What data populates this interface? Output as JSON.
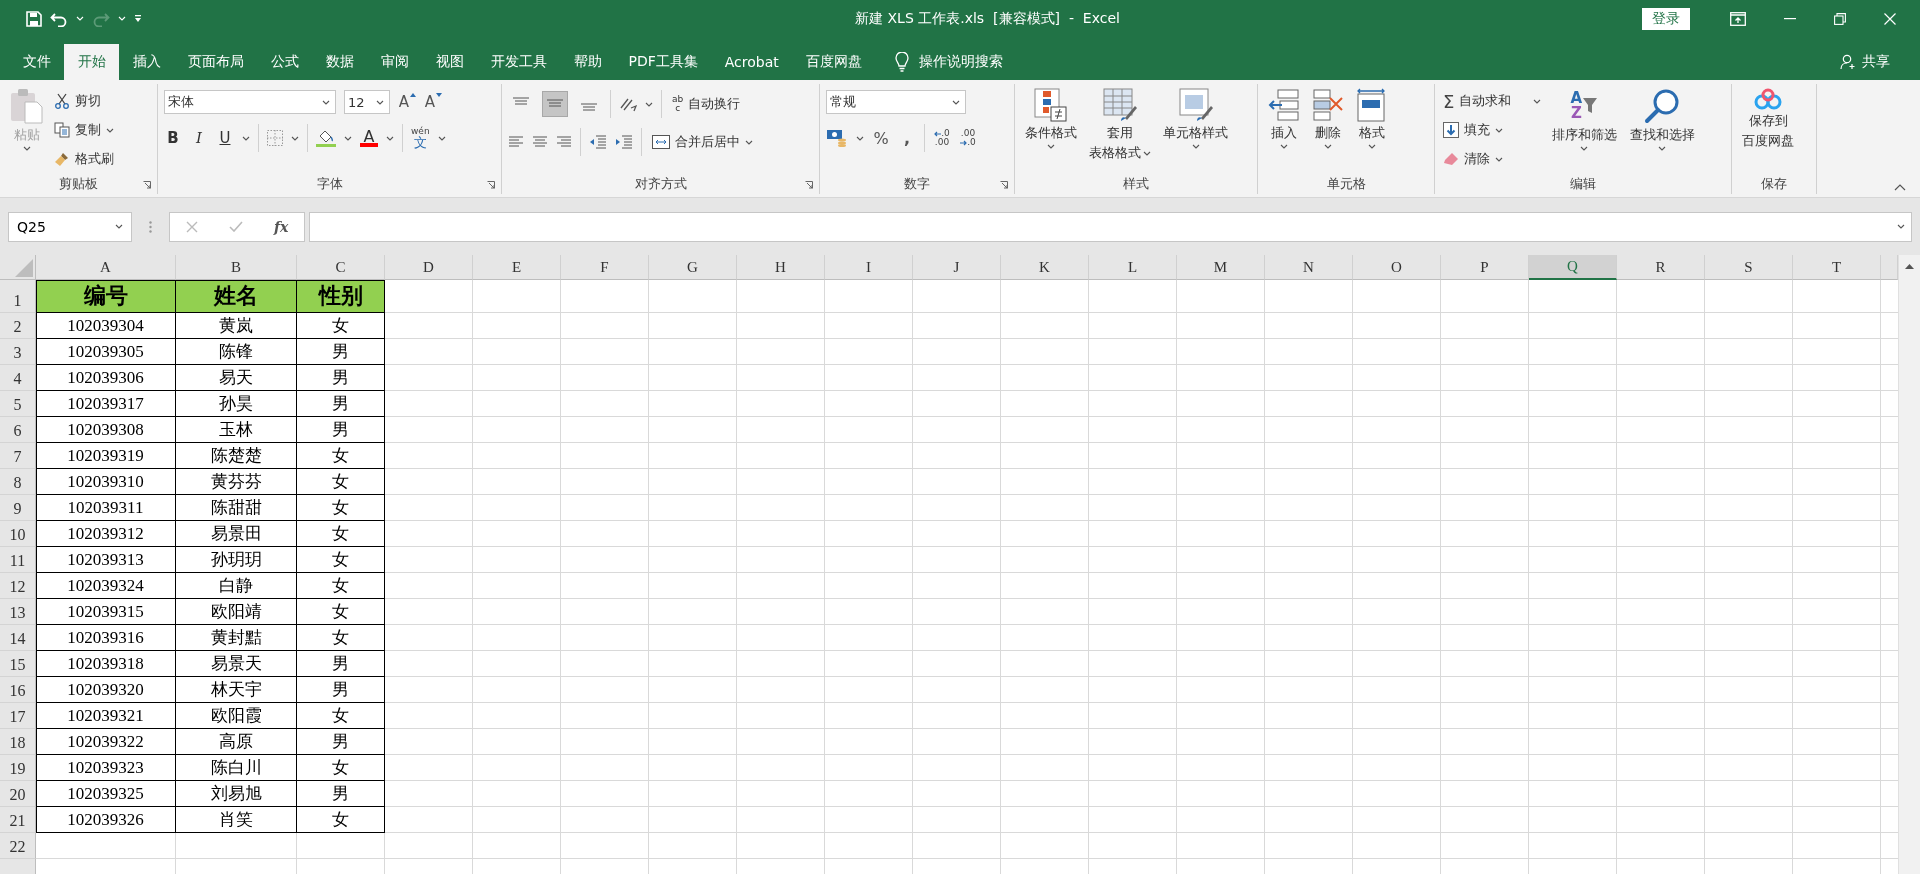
{
  "window": {
    "title": "新建 XLS 工作表.xls  [兼容模式]  -  Excel",
    "login_button": "登录"
  },
  "tabs": [
    {
      "label": "文件",
      "selected": false
    },
    {
      "label": "开始",
      "selected": true
    },
    {
      "label": "插入",
      "selected": false
    },
    {
      "label": "页面布局",
      "selected": false
    },
    {
      "label": "公式",
      "selected": false
    },
    {
      "label": "数据",
      "selected": false
    },
    {
      "label": "审阅",
      "selected": false
    },
    {
      "label": "视图",
      "selected": false
    },
    {
      "label": "开发工具",
      "selected": false
    },
    {
      "label": "帮助",
      "selected": false
    },
    {
      "label": "PDF工具集",
      "selected": false
    },
    {
      "label": "Acrobat",
      "selected": false
    },
    {
      "label": "百度网盘",
      "selected": false
    }
  ],
  "tell_me": "操作说明搜索",
  "share": "共享",
  "ribbon": {
    "clipboard": {
      "label": "剪贴板",
      "paste": {
        "label": "粘贴",
        "disabled": true
      },
      "items": [
        "剪切",
        "复制",
        "格式刷"
      ]
    },
    "font": {
      "label": "字体",
      "font_name": "宋体",
      "font_size": "12",
      "grow": "A",
      "shrink": "A",
      "styles": [
        "B",
        "I",
        "U"
      ],
      "color_letter": "A",
      "phonetic": [
        "wén",
        "文"
      ]
    },
    "alignment": {
      "label": "对齐方式",
      "vertical": [
        {
          "selected": false
        },
        {
          "selected": true
        },
        {
          "selected": false
        }
      ],
      "wrap_letters": [
        "ab",
        "c"
      ],
      "wrap_text": "自动换行",
      "merge_center": "合并后居中"
    },
    "number": {
      "label": "数字",
      "format": "常规",
      "percent": "%",
      "comma": ",",
      "increase_decimal": [
        ".0",
        ".00"
      ],
      "decrease_decimal": [
        ".00",
        ".0"
      ]
    },
    "styles": {
      "label": "样式",
      "items": [
        {
          "lines": [
            "条件格式"
          ]
        },
        {
          "lines": [
            "套用",
            "表格格式"
          ]
        },
        {
          "lines": [
            "单元格样式"
          ]
        }
      ]
    },
    "cells": {
      "label": "单元格",
      "items": [
        "插入",
        "删除",
        "格式"
      ]
    },
    "editing": {
      "label": "编辑",
      "sigma": "Σ",
      "small": [
        "自动求和",
        "填充",
        "清除"
      ],
      "sort_letters": [
        "A",
        "Z"
      ],
      "large": [
        "排序和筛选",
        "查找和选择"
      ]
    },
    "save": {
      "label": "保存",
      "button": [
        "保存到",
        "百度网盘"
      ]
    }
  },
  "formula_bar": {
    "name_box": "Q25",
    "fx": "fx"
  },
  "sheet": {
    "columns": [
      {
        "label": "A",
        "selected": false
      },
      {
        "label": "B",
        "selected": false
      },
      {
        "label": "C",
        "selected": false
      },
      {
        "label": "D",
        "selected": false
      },
      {
        "label": "E",
        "selected": false
      },
      {
        "label": "F",
        "selected": false
      },
      {
        "label": "G",
        "selected": false
      },
      {
        "label": "H",
        "selected": false
      },
      {
        "label": "I",
        "selected": false
      },
      {
        "label": "J",
        "selected": false
      },
      {
        "label": "K",
        "selected": false
      },
      {
        "label": "L",
        "selected": false
      },
      {
        "label": "M",
        "selected": false
      },
      {
        "label": "N",
        "selected": false
      },
      {
        "label": "O",
        "selected": false
      },
      {
        "label": "P",
        "selected": false
      },
      {
        "label": "Q",
        "selected": true
      },
      {
        "label": "R",
        "selected": false
      },
      {
        "label": "S",
        "selected": false
      },
      {
        "label": "T",
        "selected": false
      }
    ],
    "row_headers": [
      "1",
      "2",
      "3",
      "4",
      "5",
      "6",
      "7",
      "8",
      "9",
      "10",
      "11",
      "12",
      "13",
      "14",
      "15",
      "16",
      "17",
      "18",
      "19",
      "20",
      "21",
      "22"
    ],
    "header": [
      "编号",
      "姓名",
      "性别"
    ],
    "rows": [
      [
        "102039304",
        "黄岚",
        "女"
      ],
      [
        "102039305",
        "陈锋",
        "男"
      ],
      [
        "102039306",
        "易天",
        "男"
      ],
      [
        "102039317",
        "孙昊",
        "男"
      ],
      [
        "102039308",
        "玉林",
        "男"
      ],
      [
        "102039319",
        "陈楚楚",
        "女"
      ],
      [
        "102039310",
        "黄芬芬",
        "女"
      ],
      [
        "102039311",
        "陈甜甜",
        "女"
      ],
      [
        "102039312",
        "易景田",
        "女"
      ],
      [
        "102039313",
        "孙玥玥",
        "女"
      ],
      [
        "102039324",
        "白静",
        "女"
      ],
      [
        "102039315",
        "欧阳靖",
        "女"
      ],
      [
        "102039316",
        "黄封黠",
        "女"
      ],
      [
        "102039318",
        "易景天",
        "男"
      ],
      [
        "102039320",
        "林天宇",
        "男"
      ],
      [
        "102039321",
        "欧阳霞",
        "女"
      ],
      [
        "102039322",
        "高原",
        "男"
      ],
      [
        "102039323",
        "陈白川",
        "女"
      ],
      [
        "102039325",
        "刘易旭",
        "男"
      ],
      [
        "102039326",
        "肖笑",
        "女"
      ]
    ]
  }
}
